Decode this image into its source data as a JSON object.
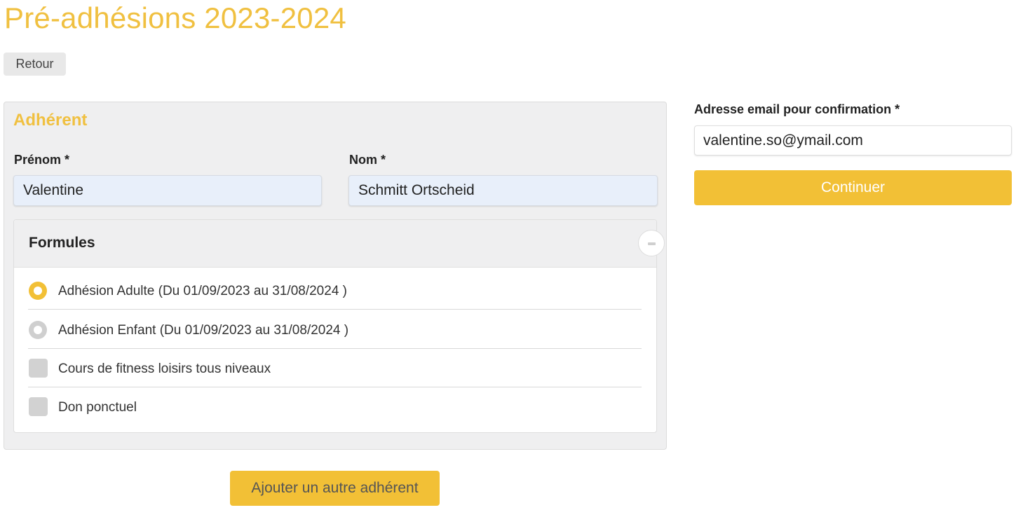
{
  "header": {
    "title": "Pré-adhésions 2023-2024",
    "back_label": "Retour"
  },
  "member": {
    "panel_title": "Adhérent",
    "first_name_label": "Prénom *",
    "first_name_value": "Valentine",
    "last_name_label": "Nom *",
    "last_name_value": "Schmitt Ortscheid",
    "formulas": {
      "title": "Formules",
      "collapse_icon": "minus-icon",
      "options": [
        {
          "type": "radio",
          "checked": true,
          "label": "Adhésion Adulte (Du 01/09/2023 au 31/08/2024 )"
        },
        {
          "type": "radio",
          "checked": false,
          "label": "Adhésion Enfant (Du 01/09/2023 au 31/08/2024 )"
        },
        {
          "type": "checkbox",
          "checked": false,
          "label": "Cours de fitness loisirs tous niveaux"
        },
        {
          "type": "checkbox",
          "checked": false,
          "label": "Don ponctuel"
        }
      ]
    },
    "add_member_label": "Ajouter un autre adhérent"
  },
  "confirmation": {
    "email_label": "Adresse email pour confirmation *",
    "email_value": "valentine.so@ymail.com",
    "continue_label": "Continuer"
  },
  "colors": {
    "accent": "#f2c036",
    "title": "#f0c040",
    "panel_bg": "#efeff0",
    "input_bg": "#e8effa"
  }
}
